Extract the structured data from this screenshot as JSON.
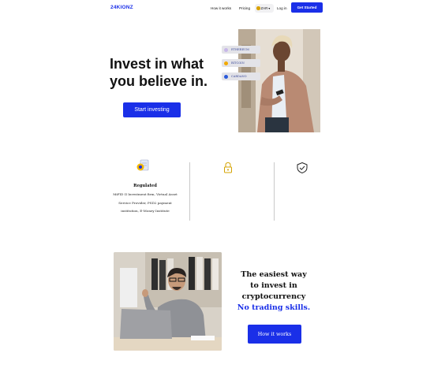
{
  "header": {
    "logo": "24KIONZ",
    "nav": {
      "how_it_works": "How it works",
      "pricing": "Pricing",
      "login": "Log in"
    },
    "currency": "ZAR",
    "cta": "Get Started"
  },
  "hero": {
    "title_line1": "Invest in what",
    "title_line2": "you believe in.",
    "button": "Start investing",
    "coins": [
      {
        "name": "ETHEREUM",
        "color": "#c7b7e8"
      },
      {
        "name": "BITCOIN",
        "color": "#f2a900"
      },
      {
        "name": "CARDANO",
        "color": "#2a5ada"
      }
    ]
  },
  "features": {
    "regulated_title": "Regulated",
    "regulated_lines": [
      "MiFID II Investment firm, Virtual Asset",
      "Service Provider, PSD2 payment",
      "institution, E-Money Institute"
    ]
  },
  "promo": {
    "line1": "The easiest way",
    "line2": "to invest in",
    "line3": "cryptocurrency",
    "line4": "No trading skills.",
    "button": "How it works"
  },
  "colors": {
    "brand": "#1a2fe8"
  }
}
